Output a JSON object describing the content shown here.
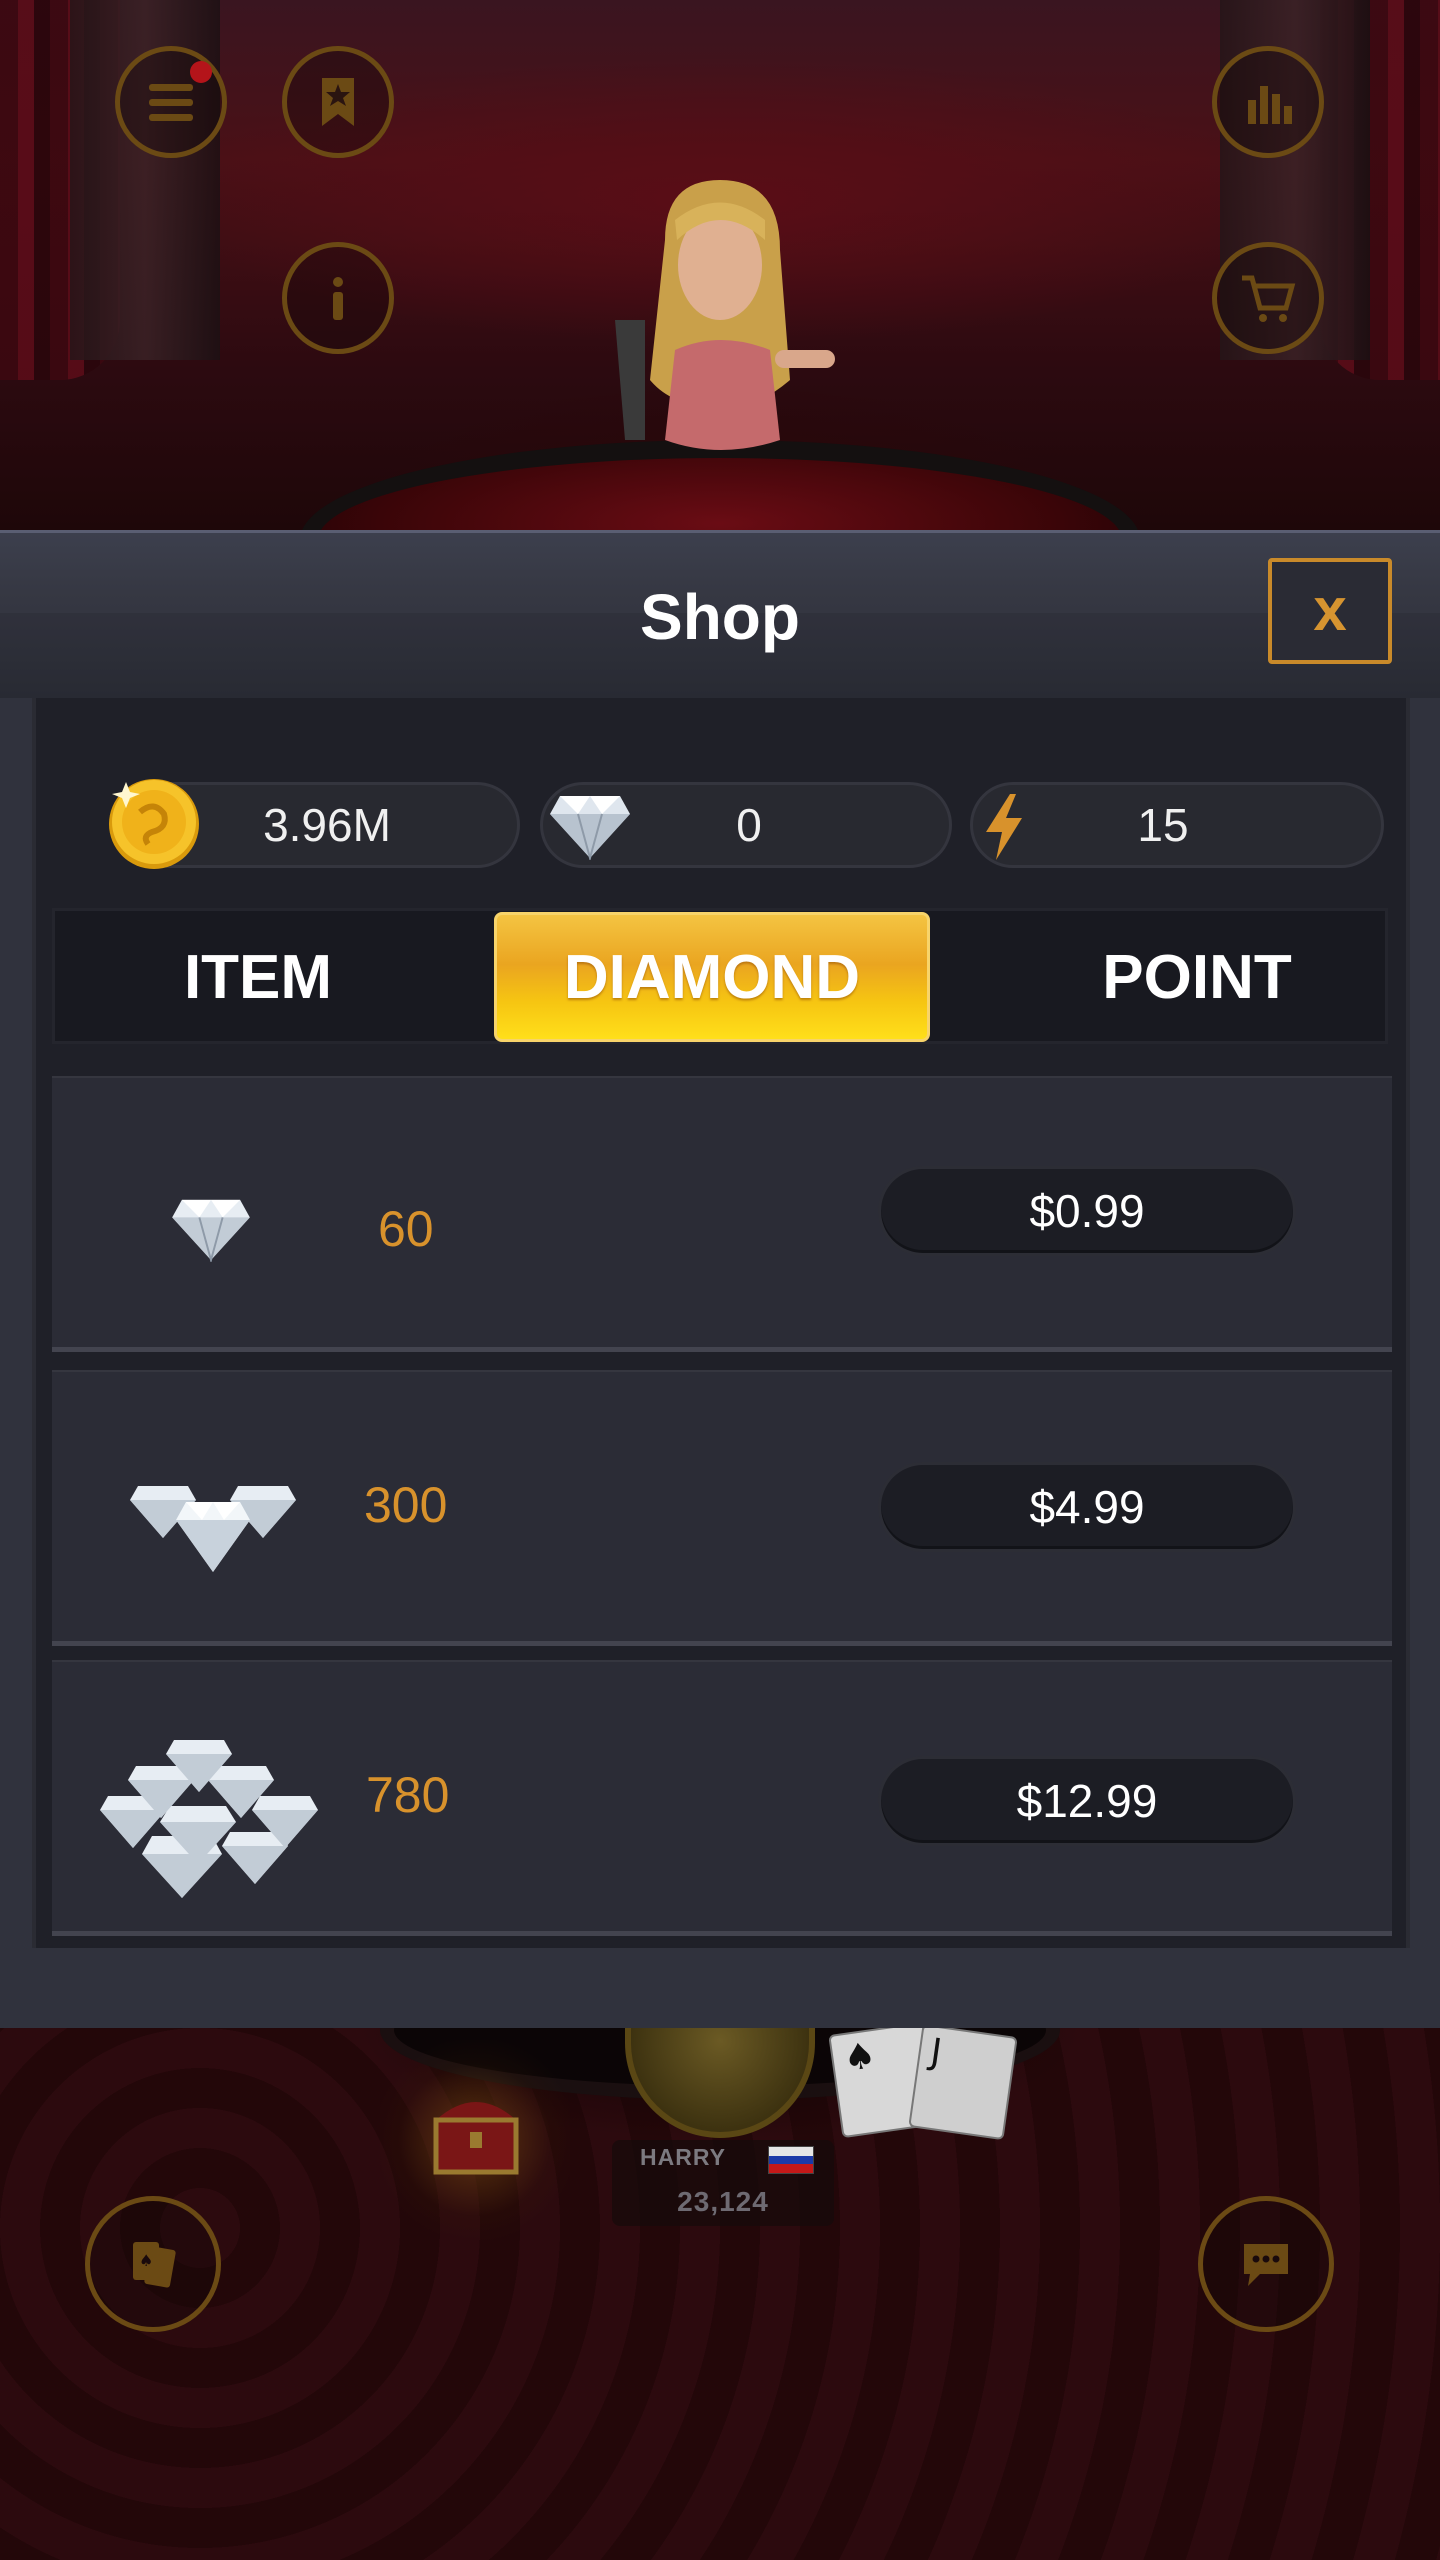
{
  "modal": {
    "title": "Shop",
    "close_label": "x"
  },
  "balances": {
    "coins": "3.96M",
    "diamonds": "0",
    "energy": "15"
  },
  "tabs": [
    {
      "label": "ITEM",
      "active": false
    },
    {
      "label": "DIAMOND",
      "active": true
    },
    {
      "label": "POINT",
      "active": false
    }
  ],
  "products": [
    {
      "quantity": "60",
      "price": "$0.99",
      "icon": "diamond-single-icon"
    },
    {
      "quantity": "300",
      "price": "$4.99",
      "icon": "diamond-trio-icon"
    },
    {
      "quantity": "780",
      "price": "$12.99",
      "icon": "diamond-pile-icon"
    }
  ],
  "player": {
    "name": "HARRY",
    "chips": "23,124",
    "flag": "russia-flag"
  },
  "icons": {
    "top_left": [
      "menu-icon",
      "bookmark-star-icon",
      "info-icon"
    ],
    "top_right": [
      "stats-icon",
      "cart-icon"
    ],
    "bottom": [
      "cards-icon",
      "chat-icon",
      "treasure-chest-icon"
    ]
  },
  "colors": {
    "accent_gold": "#d8922c",
    "tab_active": "#f6c512",
    "notification": "#b4141a"
  }
}
